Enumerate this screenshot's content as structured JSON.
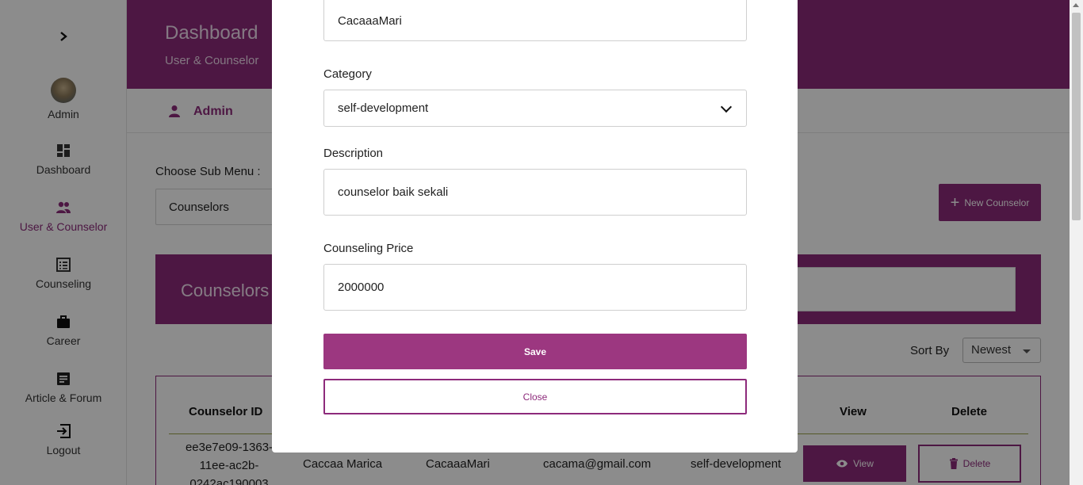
{
  "sidebar": {
    "toggle_icon": "chevron-right-icon",
    "items": [
      {
        "label": "Admin",
        "icon": "avatar"
      },
      {
        "label": "Dashboard",
        "icon": "dashboard-icon"
      },
      {
        "label": "User & Counselor",
        "icon": "users-icon",
        "active": true
      },
      {
        "label": "Counseling",
        "icon": "list-icon"
      },
      {
        "label": "Career",
        "icon": "briefcase-icon"
      },
      {
        "label": "Article & Forum",
        "icon": "article-icon"
      },
      {
        "label": "Logout",
        "icon": "logout-icon"
      }
    ]
  },
  "header": {
    "title": "Dashboard",
    "subtitle": "User & Counselor"
  },
  "userbar": {
    "name": "Admin"
  },
  "submenu": {
    "label": "Choose Sub Menu :",
    "selected": "Counselors"
  },
  "new_button": {
    "label": "New Counselor"
  },
  "banner": {
    "title": "Counselors"
  },
  "sort": {
    "label": "Sort By",
    "selected": "Newest"
  },
  "table": {
    "headers": {
      "id": "Counselor ID",
      "view": "View",
      "delete": "Delete"
    },
    "row": {
      "id_line1": "ee3e7e09-1363-",
      "id_line2": "11ee-ac2b-",
      "id_line3": "0242ac190003",
      "name": "Caccaa Marica",
      "username": "CacaaaMari",
      "email": "cacama@gmail.com",
      "category": "self-development",
      "view_label": "View",
      "delete_label": "Delete"
    }
  },
  "modal": {
    "username_value": "CacaaaMari",
    "category_label": "Category",
    "category_value": "self-development",
    "description_label": "Description",
    "description_value": "counselor baik sekali",
    "price_label": "Counseling Price",
    "price_value": "2000000",
    "save_label": "Save",
    "close_label": "Close"
  },
  "colors": {
    "primary": "#8d2a7b",
    "button": "#9c3780"
  }
}
